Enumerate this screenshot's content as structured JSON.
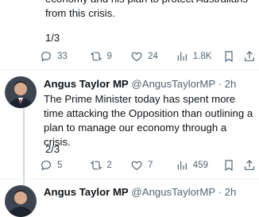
{
  "tweet1": {
    "text_line1": "economy and his plan to protect Australians",
    "text_line2": "from this crisis.",
    "counter": "1/3",
    "replies": "33",
    "retweets": "9",
    "likes": "24",
    "views": "1.8K"
  },
  "tweet2": {
    "name": "Angus Taylor MP",
    "handle": "@AngusTaylorMP",
    "time": "· 2h",
    "text": "The Prime Minister today has spent more time attacking the Opposition than outlining a plan to manage our economy through a crisis.",
    "counter": "2/3",
    "replies": "5",
    "retweets": "2",
    "likes": "7",
    "views": "459"
  },
  "tweet3": {
    "name": "Angus Taylor MP",
    "handle": "@AngusTaylorMP",
    "time": "· 2h"
  },
  "icons": {
    "reply": "reply-icon",
    "retweet": "retweet-icon",
    "like": "heart-icon",
    "views": "views-icon",
    "bookmark": "bookmark-icon",
    "share": "share-icon"
  }
}
